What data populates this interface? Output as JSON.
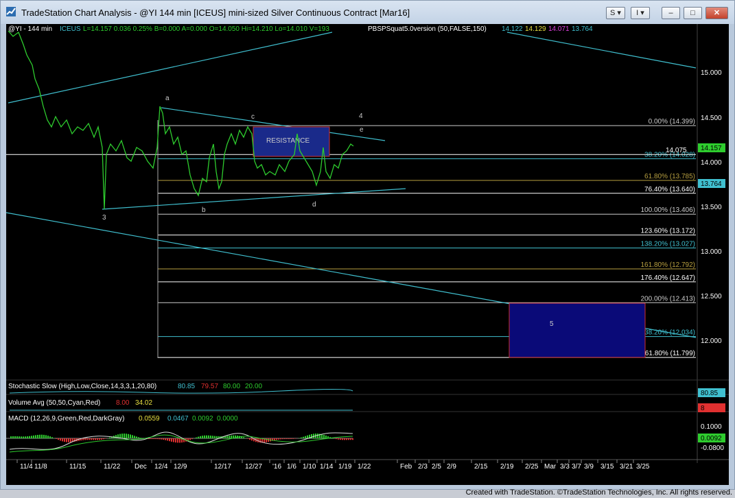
{
  "window": {
    "title": "TradeStation Chart Analysis - @YI 144 min [ICEUS] mini-sized Silver Continuous Contract [Mar16]",
    "buttons": {
      "s_label": "S ▾",
      "i_label": "I ▾",
      "minimize": "–",
      "maximize": "□",
      "close": "✕"
    }
  },
  "header": {
    "symbol": "@YI - 144 min",
    "exchange": "ICEUS",
    "stats": "L=14.157  0.036  0.25%  B=0.000  A=0.000  O=14.050  Hi=14.210  Lo=14.010  V=193",
    "indicator": "PBSPSquat5.0version (50,FALSE,150)",
    "ind_values": [
      "14.122",
      "14.129",
      "14.071",
      "13.764"
    ]
  },
  "colors": {
    "bg": "#000000",
    "price_bars": "#2ecc2e",
    "channel": "#40c0d0",
    "fib": "#ffffff",
    "resistance_fill": "#1a2a8a",
    "resistance_border": "#d03030",
    "target_fill": "#0a0a78",
    "axis_text": "#ffffff"
  },
  "price_axis": {
    "ticks": [
      "15.000",
      "14.500",
      "14.000",
      "13.500",
      "13.000",
      "12.500",
      "12.000"
    ],
    "badges": [
      {
        "text": "14.157",
        "color": "#2ecc2e"
      },
      {
        "text": "13.764",
        "color": "#40c0d0"
      }
    ]
  },
  "fib_levels": [
    {
      "label": "0.00% (14.399)",
      "price": 14.399,
      "color": "#cccccc"
    },
    {
      "label": "38.20% (14.028)",
      "price": 14.028,
      "color": "#40c0d0"
    },
    {
      "label": "61.80% (13.785)",
      "price": 13.785,
      "color": "#b8a040"
    },
    {
      "label": "76.40% (13.640)",
      "price": 13.64,
      "color": "#ffffff"
    },
    {
      "label": "100.00% (13.406)",
      "price": 13.406,
      "color": "#cccccc"
    },
    {
      "label": "123.60% (13.172)",
      "price": 13.172,
      "color": "#ffffff"
    },
    {
      "label": "138.20% (13.027)",
      "price": 13.027,
      "color": "#40c0d0"
    },
    {
      "label": "161.80% (12.792)",
      "price": 12.792,
      "color": "#b8a040"
    },
    {
      "label": "176.40% (12.647)",
      "price": 12.647,
      "color": "#ffffff"
    },
    {
      "label": "200.00% (12.413)",
      "price": 12.413,
      "color": "#cccccc"
    },
    {
      "label": "238.20% (12.034)",
      "price": 12.034,
      "color": "#40c0d0"
    },
    {
      "label": "261.80% (11.799)",
      "price": 11.799,
      "color": "#ffffff"
    }
  ],
  "level_14075": "14.075",
  "annotations": {
    "resistance": "RESISTANCE",
    "target": "5",
    "waves": [
      "3",
      "a",
      "b",
      "c",
      "d",
      "4",
      "e"
    ]
  },
  "subgraphs": {
    "stochastic": {
      "label": "Stochastic Slow (High,Low,Close,14,3,3,1,20,80)",
      "values": [
        "80.85",
        "79.57",
        "80.00",
        "20.00"
      ],
      "badge": "80.85"
    },
    "volume": {
      "label": "Volume Avg (50,50,Cyan,Red)",
      "values": [
        "8.00",
        "34.02"
      ],
      "badge": "8"
    },
    "macd": {
      "label": "MACD (12,26,9,Green,Red,DarkGray)",
      "values": [
        "0.0559",
        "0.0467",
        "0.0092",
        "0.0000"
      ],
      "ticks": [
        "0.1000",
        "-0.0800"
      ],
      "badge": "0.0092"
    }
  },
  "time_axis": [
    "11/4",
    "11/8",
    "11/15",
    "11/22",
    "Dec",
    "12/4",
    "12/9",
    "12/17",
    "12/27",
    "'16",
    "1/6",
    "1/10",
    "1/14",
    "1/19",
    "1/22",
    "Feb",
    "2/3",
    "2/5",
    "2/9",
    "2/15",
    "2/19",
    "2/25",
    "Mar",
    "3/3",
    "3/7",
    "3/9",
    "3/15",
    "3/21",
    "3/25"
  ],
  "footer": {
    "credit": "Created with TradeStation. ©TradeStation Technologies, Inc. All rights reserved."
  }
}
